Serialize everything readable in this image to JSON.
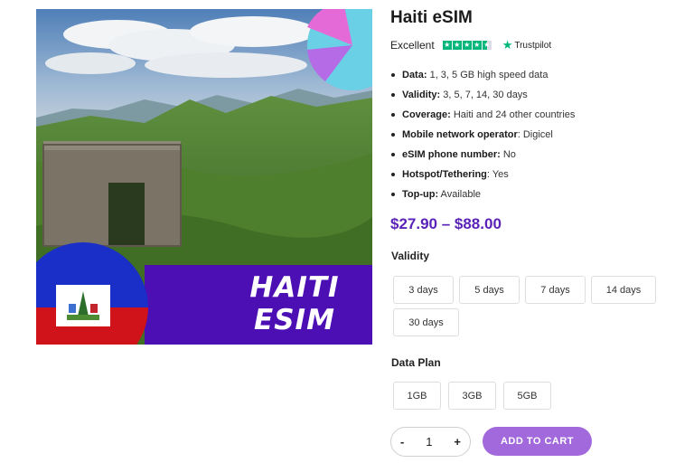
{
  "product": {
    "title": "Haiti eSIM",
    "image_banner_line1": "HAITI",
    "image_banner_line2": "ESIM",
    "price_range": "$27.90 – $88.00"
  },
  "rating": {
    "label": "Excellent",
    "stars": 4.5,
    "provider": "Trustpilot",
    "provider_icon": "star-icon",
    "color": "#00b67a"
  },
  "features": [
    {
      "label": "Data:",
      "value": " 1, 3, 5 GB high speed data"
    },
    {
      "label": "Validity:",
      "value": " 3, 5, 7, 14, 30 days"
    },
    {
      "label": "Coverage:",
      "value": " Haiti and 24 other countries"
    },
    {
      "label": "Mobile network operator",
      "value": ": Digicel"
    },
    {
      "label": "eSIM phone number:",
      "value": " No"
    },
    {
      "label": "Hotspot/Tethering",
      "value": ": Yes"
    },
    {
      "label": "Top-up:",
      "value": " Available"
    }
  ],
  "validity": {
    "label": "Validity",
    "options": [
      "3 days",
      "5 days",
      "7 days",
      "14 days",
      "30 days"
    ]
  },
  "data_plan": {
    "label": "Data Plan",
    "options": [
      "1GB",
      "3GB",
      "5GB"
    ]
  },
  "cart": {
    "minus": "-",
    "quantity": "1",
    "plus": "+",
    "add_label": "ADD TO CART"
  },
  "colors": {
    "accent": "#5a22b8",
    "button": "#a269dc",
    "banner": "#4b0fb4",
    "flag_blue": "#1a2fc8",
    "flag_red": "#d0121b"
  }
}
